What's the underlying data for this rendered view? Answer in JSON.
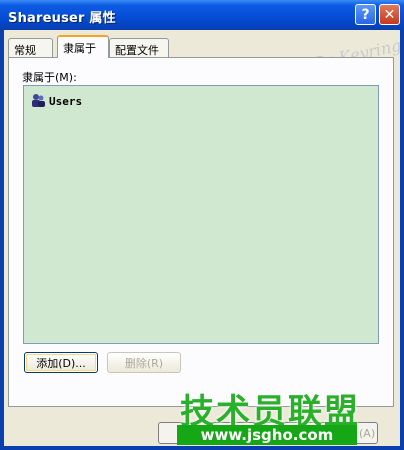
{
  "window": {
    "title": "Shareuser 属性",
    "help_glyph": "?",
    "close_glyph": "✕"
  },
  "tabs": [
    {
      "label": "常规"
    },
    {
      "label": "隶属于"
    },
    {
      "label": "配置文件"
    }
  ],
  "membership": {
    "label": "隶属于(M):",
    "items": [
      {
        "name": "Users",
        "icon": "group-icon"
      }
    ]
  },
  "buttons": {
    "add": "添加(D)...",
    "remove": "删除(R)",
    "apply_partial": "(A)"
  },
  "overlay": {
    "watermark": "百度经验 By Keyring",
    "brand": "技术员联盟",
    "brand_url": "www.jsgho.com"
  }
}
